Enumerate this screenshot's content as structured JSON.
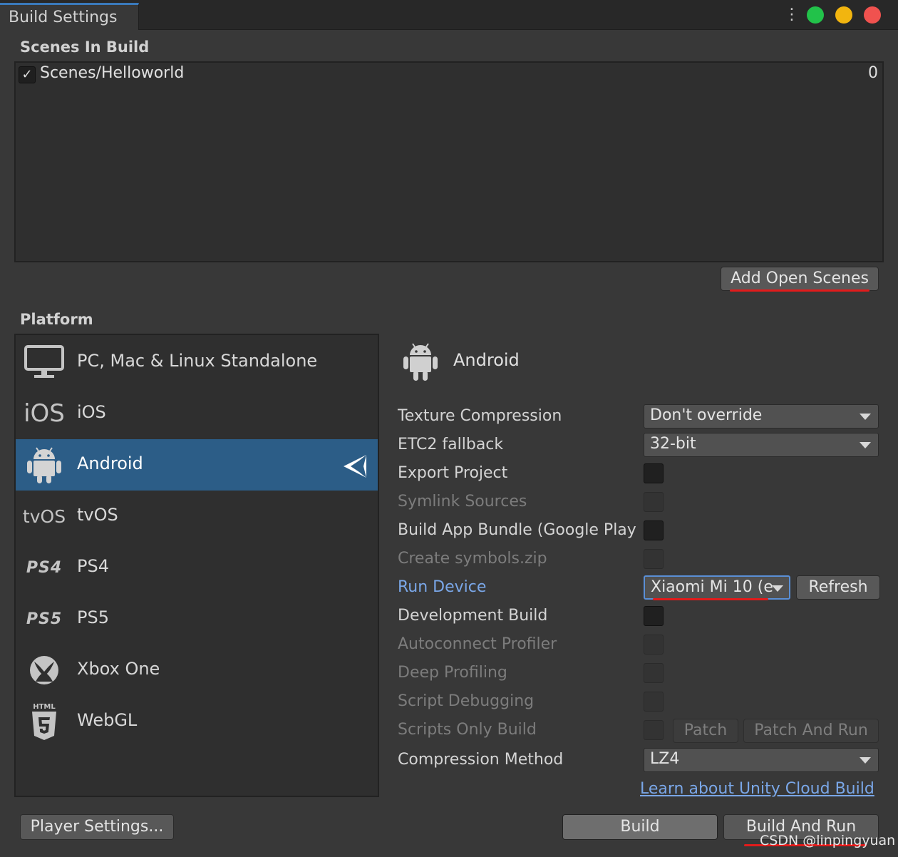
{
  "window": {
    "tab_title": "Build Settings",
    "menu_icon": "kebab-icon",
    "traffic_lights": {
      "green": "#22c24a",
      "yellow": "#f2b50f",
      "red": "#f0524f"
    }
  },
  "scenes": {
    "section_title": "Scenes In Build",
    "items": [
      {
        "name": "Scenes/Helloworld",
        "index": "0",
        "checked": true
      }
    ],
    "add_open_scenes_label": "Add Open Scenes"
  },
  "platform": {
    "section_title": "Platform",
    "items": [
      {
        "label": "PC, Mac & Linux Standalone",
        "icon": "monitor-icon",
        "icon_text": ""
      },
      {
        "label": "iOS",
        "icon": "ios-icon",
        "icon_text": "iOS"
      },
      {
        "label": "Android",
        "icon": "android-icon",
        "icon_text": "",
        "selected": true,
        "active_icon": "unity-logo-icon"
      },
      {
        "label": "tvOS",
        "icon": "tvos-icon",
        "icon_text": "tvOS"
      },
      {
        "label": "PS4",
        "icon": "ps4-icon",
        "icon_text": "PS4"
      },
      {
        "label": "PS5",
        "icon": "ps5-icon",
        "icon_text": "PS5"
      },
      {
        "label": "Xbox One",
        "icon": "xbox-icon",
        "icon_text": ""
      },
      {
        "label": "WebGL",
        "icon": "html5-icon",
        "icon_text": "HTML"
      }
    ],
    "player_settings_label": "Player Settings..."
  },
  "android": {
    "header_title": "Android",
    "texture_compression": {
      "label": "Texture Compression",
      "value": "Don't override"
    },
    "etc2_fallback": {
      "label": "ETC2 fallback",
      "value": "32-bit"
    },
    "export_project": {
      "label": "Export Project"
    },
    "symlink_sources": {
      "label": "Symlink Sources"
    },
    "build_app_bundle": {
      "label": "Build App Bundle (Google Play"
    },
    "create_symbols": {
      "label": "Create symbols.zip"
    },
    "run_device": {
      "label": "Run Device",
      "value": "Xiaomi Mi 10 (e",
      "refresh_label": "Refresh"
    },
    "development_build": {
      "label": "Development Build"
    },
    "autoconnect_profiler": {
      "label": "Autoconnect Profiler"
    },
    "deep_profiling": {
      "label": "Deep Profiling"
    },
    "script_debugging": {
      "label": "Script Debugging"
    },
    "scripts_only_build": {
      "label": "Scripts Only Build",
      "patch_label": "Patch",
      "patch_and_run_label": "Patch And Run"
    },
    "compression_method": {
      "label": "Compression Method",
      "value": "LZ4"
    },
    "cloud_build_link": "Learn about Unity Cloud Build"
  },
  "footer": {
    "build_label": "Build",
    "build_and_run_label": "Build And Run"
  },
  "watermark": "CSDN @linpingyuan"
}
